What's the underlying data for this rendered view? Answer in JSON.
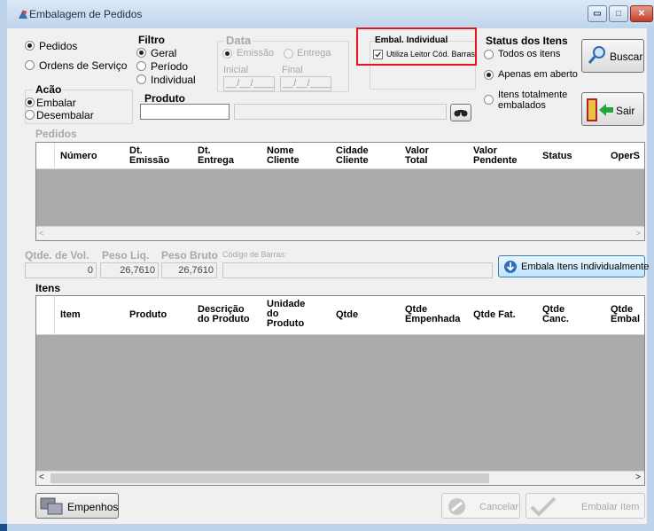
{
  "window": {
    "title": "Embalagem de Pedidos",
    "min_glyph": "▭",
    "max_glyph": "□",
    "close_glyph": "✕"
  },
  "tipo": {
    "pedidos": "Pedidos",
    "ordens": "Ordens de Serviço"
  },
  "filtro": {
    "title": "Filtro",
    "geral": "Geral",
    "periodo": "Período",
    "individual": "Individual"
  },
  "data": {
    "title": "Data",
    "emissao": "Emissão",
    "entrega": "Entrega",
    "inicial": "Inicial",
    "final": "Final",
    "inicial_value": "__/__/____",
    "final_value": "__/__/____"
  },
  "embal": {
    "title": "Embal. Individual",
    "leitor_label": "Utiliza Leitor Cód. Barras",
    "leitor_checked": true
  },
  "status": {
    "title": "Status dos Itens",
    "todos": "Todos os itens",
    "aberto": "Apenas em aberto",
    "embalados": "Itens totalmente embalados"
  },
  "acao": {
    "title": "Acão",
    "embalar": "Embalar",
    "desembalar": "Desembalar"
  },
  "produto": {
    "title": "Produto",
    "value": ""
  },
  "buttons": {
    "buscar": "Buscar",
    "sair": "Sair",
    "embala_individual": "Embala Itens Individualmente",
    "empenhos": "Empenhos",
    "cancelar": "Cancelar",
    "embalar_item": "Embalar Item"
  },
  "pedidos": {
    "title": "Pedidos",
    "columns": [
      {
        "l1": "Número",
        "l2": ""
      },
      {
        "l1": "Dt.",
        "l2": "Emissão"
      },
      {
        "l1": "Dt.",
        "l2": "Entrega"
      },
      {
        "l1": "Nome",
        "l2": "Cliente"
      },
      {
        "l1": "Cidade",
        "l2": "Cliente"
      },
      {
        "l1": "Valor",
        "l2": "Total"
      },
      {
        "l1": "Valor",
        "l2": "Pendente"
      },
      {
        "l1": "Status",
        "l2": ""
      },
      {
        "l1": "OperS",
        "l2": ""
      }
    ]
  },
  "totals": {
    "qtde_vol_label": "Qtde. de Vol.",
    "qtde_vol": "0",
    "peso_liq_label": "Peso Liq.",
    "peso_liq": "26,7610",
    "peso_bruto_label": "Peso Bruto",
    "peso_bruto": "26,7610",
    "codigo_label": "Código de Barras:",
    "codigo_value": ""
  },
  "itens": {
    "title": "Itens",
    "columns": [
      {
        "l1": "Item",
        "l2": "",
        "l3": ""
      },
      {
        "l1": "Produto",
        "l2": "",
        "l3": ""
      },
      {
        "l1": "Descrição",
        "l2": "do Produto",
        "l3": ""
      },
      {
        "l1": "Unidade",
        "l2": "do",
        "l3": "Produto"
      },
      {
        "l1": "Qtde",
        "l2": "",
        "l3": ""
      },
      {
        "l1": "Qtde",
        "l2": "Empenhada",
        "l3": ""
      },
      {
        "l1": "Qtde Fat.",
        "l2": "",
        "l3": ""
      },
      {
        "l1": "Qtde",
        "l2": "Canc.",
        "l3": ""
      },
      {
        "l1": "Qtde",
        "l2": "Embal",
        "l3": ""
      }
    ]
  },
  "colors": {
    "highlight": "#e8141e",
    "grid_body": "#ababab",
    "taskbar": "#1c4f8a"
  }
}
